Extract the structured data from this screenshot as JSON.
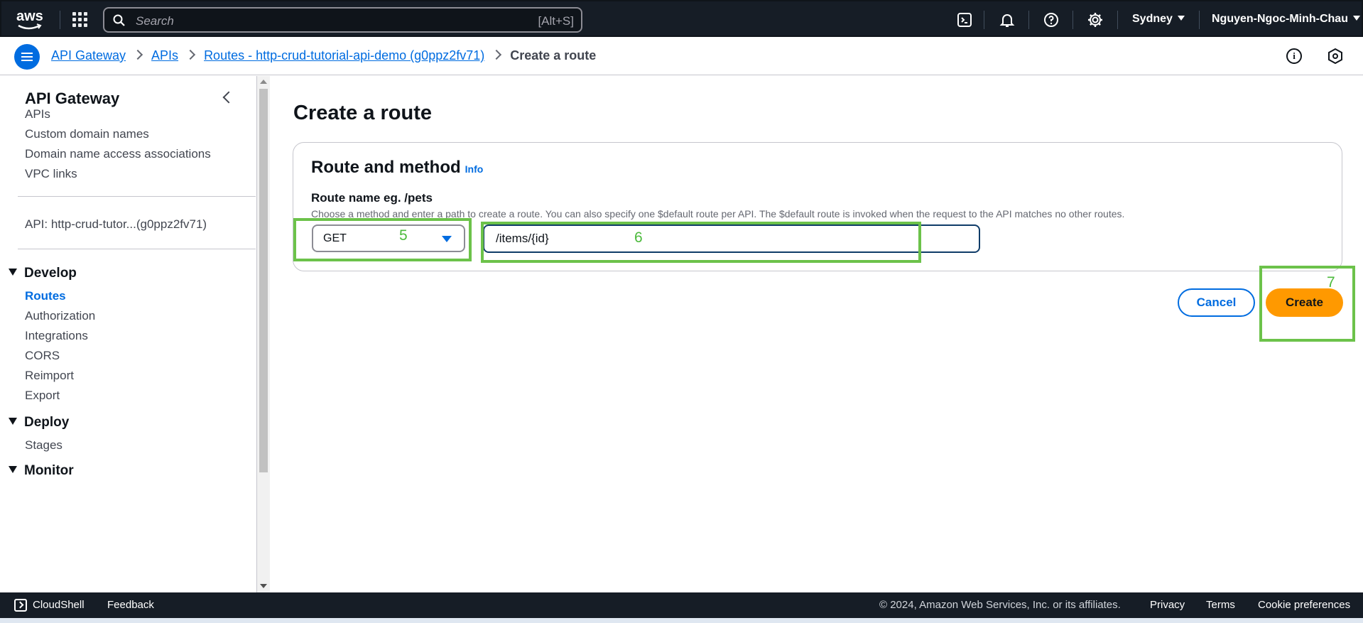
{
  "topbar": {
    "logo_text": "aws",
    "search_placeholder": "Search",
    "search_shortcut": "[Alt+S]",
    "icons": [
      "cloudshell-icon",
      "bell-icon",
      "help-icon",
      "gear-icon"
    ],
    "region": "Sydney",
    "user": "Nguyen-Ngoc-Minh-Chau"
  },
  "breadcrumb": {
    "items": [
      "API Gateway",
      "APIs",
      "Routes - http-crud-tutorial-api-demo (g0ppz2fv71)"
    ],
    "current": "Create a route"
  },
  "sidebar": {
    "title": "API Gateway",
    "links": [
      "APIs",
      "Custom domain names",
      "Domain name access associations",
      "VPC links"
    ],
    "api_label": "API: http-crud-tutor...(g0ppz2fv71)",
    "develop": {
      "title": "Develop",
      "items": [
        "Routes",
        "Authorization",
        "Integrations",
        "CORS",
        "Reimport",
        "Export"
      ],
      "active": "Routes"
    },
    "deploy": {
      "title": "Deploy",
      "items": [
        "Stages"
      ]
    },
    "monitor": {
      "title": "Monitor"
    }
  },
  "main": {
    "title": "Create a route",
    "card_title": "Route and method",
    "info_link": "Info",
    "route_label": "Route name eg. /pets",
    "route_description": "Choose a method and enter a path to create a route. You can also specify one $default route per API. The $default route is invoked when the request to the API matches no other routes.",
    "method_value": "GET",
    "path_value": "/items/{id}",
    "cancel_label": "Cancel",
    "create_label": "Create"
  },
  "annotations": [
    "5",
    "6",
    "7"
  ],
  "footer": {
    "cloudshell": "CloudShell",
    "feedback": "Feedback",
    "copyright": "© 2024, Amazon Web Services, Inc. or its affiliates.",
    "privacy": "Privacy",
    "terms": "Terms",
    "cookies": "Cookie preferences"
  },
  "colors": {
    "nav_bg": "#161d26",
    "link": "#006ce0",
    "primary_button": "#ff9900",
    "annotation": "#6cc24a"
  }
}
